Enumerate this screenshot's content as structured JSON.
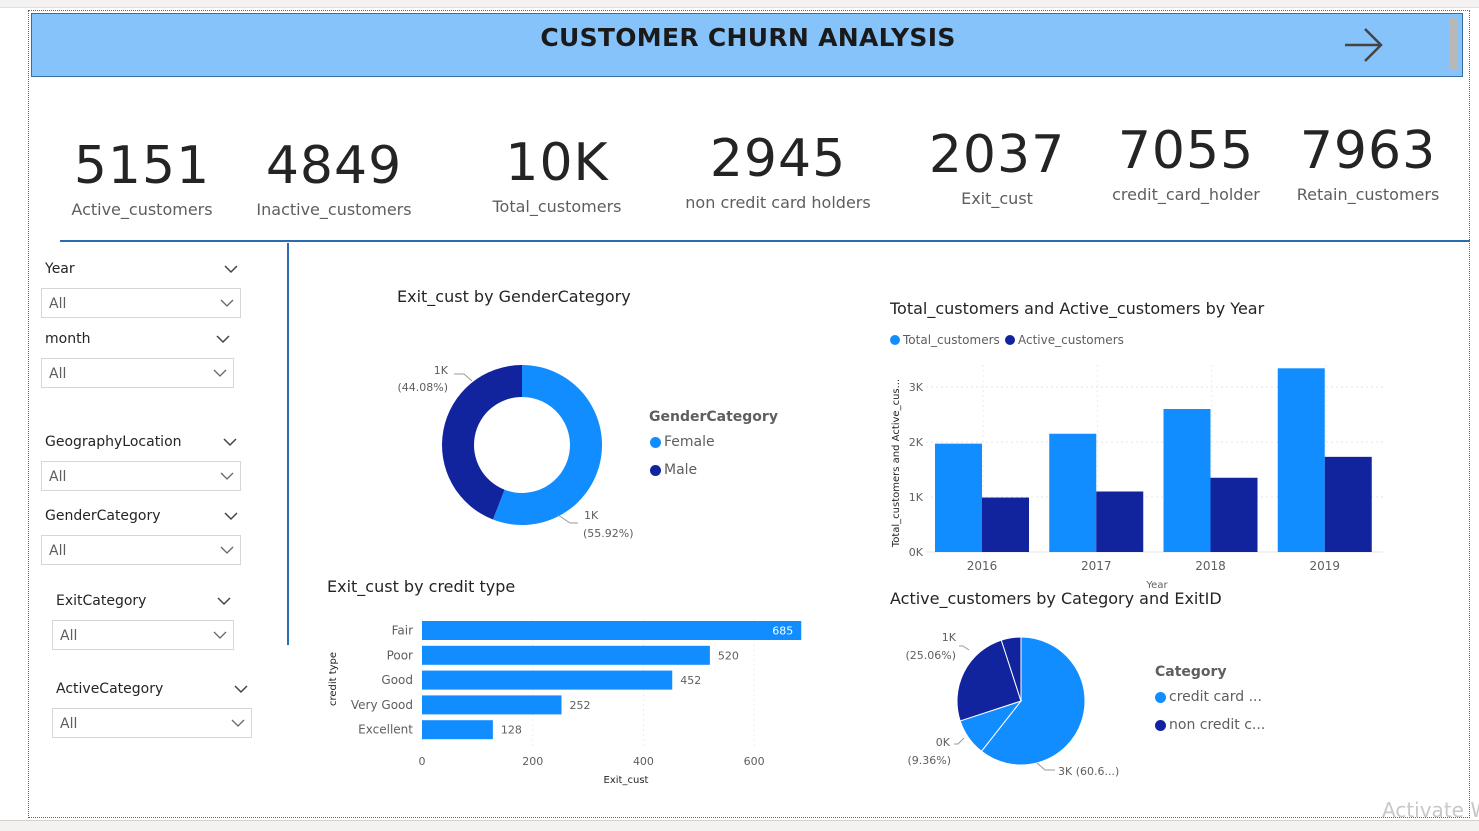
{
  "header": {
    "title": "CUSTOMER CHURN ANALYSIS"
  },
  "kpis": [
    {
      "value": "5151",
      "label": "Active_customers"
    },
    {
      "value": "4849",
      "label": "Inactive_customers"
    },
    {
      "value": "10K",
      "label": "Total_customers"
    },
    {
      "value": "2945",
      "label": "non credit card holders"
    },
    {
      "value": "2037",
      "label": "Exit_cust"
    },
    {
      "value": "7055",
      "label": "credit_card_holder"
    },
    {
      "value": "7963",
      "label": "Retain_customers"
    }
  ],
  "slicers": [
    {
      "title": "Year",
      "value": "All"
    },
    {
      "title": "month",
      "value": "All"
    },
    {
      "title": "GeographyLocation",
      "value": "All"
    },
    {
      "title": "GenderCategory",
      "value": "All"
    },
    {
      "title": "ExitCategory",
      "value": "All"
    },
    {
      "title": "ActiveCategory",
      "value": "All"
    }
  ],
  "colors": {
    "primary": "#118DFF",
    "secondary": "#12239E",
    "header_bg": "#86C3FB",
    "accent_line": "#2B6CB0"
  },
  "watermark": "Activate W",
  "chart_data": [
    {
      "type": "pie",
      "subtype": "donut",
      "title": "Exit_cust by GenderCategory",
      "legend_title": "GenderCategory",
      "legend_position": "right",
      "slices": [
        {
          "name": "Female",
          "value": 1139,
          "label": "1K",
          "percent_label": "(55.92%)",
          "color": "#118DFF"
        },
        {
          "name": "Male",
          "value": 898,
          "label": "1K",
          "percent_label": "(44.08%)",
          "color": "#12239E"
        }
      ]
    },
    {
      "type": "bar",
      "title": "Total_customers and Active_customers by Year",
      "xlabel": "Year",
      "ylabel": "Total_customers and Active_cus...",
      "categories": [
        "2016",
        "2017",
        "2018",
        "2019"
      ],
      "yticks": [
        "0K",
        "1K",
        "2K",
        "3K"
      ],
      "ylim": [
        0,
        3400
      ],
      "legend_position": "top-left",
      "grid": true,
      "series": [
        {
          "name": "Total_customers",
          "color": "#118DFF",
          "values": [
            1970,
            2150,
            2600,
            3340
          ]
        },
        {
          "name": "Active_customers",
          "color": "#12239E",
          "values": [
            990,
            1100,
            1350,
            1730
          ]
        }
      ]
    },
    {
      "type": "bar",
      "orientation": "horizontal",
      "title": "Exit_cust by credit type",
      "xlabel": "Exit_cust",
      "ylabel": "credit type",
      "categories": [
        "Fair",
        "Poor",
        "Good",
        "Very Good",
        "Excellent"
      ],
      "values": [
        685,
        520,
        452,
        252,
        128
      ],
      "value_labels": [
        "685",
        "520",
        "452",
        "252",
        "128"
      ],
      "xticks": [
        "0",
        "200",
        "400",
        "600"
      ],
      "xlim": [
        0,
        690
      ],
      "color": "#118DFF"
    },
    {
      "type": "pie",
      "title": "Active_customers by Category and ExitID",
      "legend_title": "Category",
      "legend_position": "right",
      "legend": [
        {
          "name": "credit card ...",
          "color": "#118DFF"
        },
        {
          "name": "non credit c...",
          "color": "#12239E"
        }
      ],
      "slices": [
        {
          "category": "credit card ...",
          "value": 60.6,
          "label": "3K",
          "percent_label": "(60.6...)",
          "color": "#118DFF"
        },
        {
          "category": "credit card ...",
          "value": 9.36,
          "label": "0K",
          "percent_label": "(9.36%)",
          "color": "#118DFF"
        },
        {
          "category": "non credit c...",
          "value": 25.06,
          "label": "1K",
          "percent_label": "(25.06%)",
          "color": "#12239E"
        },
        {
          "category": "non credit c...",
          "value": 4.98,
          "label": "",
          "percent_label": "",
          "color": "#12239E"
        }
      ]
    }
  ]
}
